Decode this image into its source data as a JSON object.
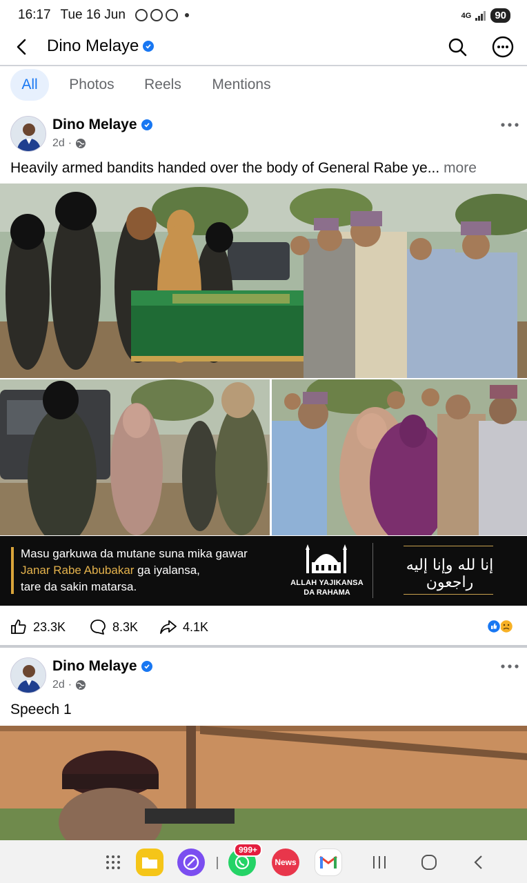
{
  "status": {
    "time": "16:17",
    "date": "Tue 16 Jun",
    "network": "4G",
    "battery": "90"
  },
  "header": {
    "title": "Dino Melaye"
  },
  "tabs": [
    {
      "label": "All",
      "active": true
    },
    {
      "label": "Photos",
      "active": false
    },
    {
      "label": "Reels",
      "active": false
    },
    {
      "label": "Mentions",
      "active": false
    }
  ],
  "posts": [
    {
      "author": "Dino Melaye",
      "time": "2d",
      "text": "Heavily armed bandits handed over the body of General Rabe ye...",
      "more": "more",
      "banner": {
        "line1": "Masu garkuwa da mutane suna mika gawar",
        "line2_highlight": "Janar Rabe Abubakar",
        "line2_rest": " ga iyalansa,",
        "line3": "tare da sakin matarsa.",
        "caption1": "ALLAH YAJIKANSA",
        "caption2": "DA RAHAMA",
        "arabic": "إنا لله وإنا إليه راجعون"
      },
      "likes": "23.3K",
      "comments": "8.3K",
      "shares": "4.1K"
    },
    {
      "author": "Dino Melaye",
      "time": "2d",
      "text": "Speech 1"
    }
  ],
  "navbar": {
    "badge": "999+",
    "news_label": "News"
  },
  "colors": {
    "accent": "#1877f2",
    "gold": "#e4b24c"
  }
}
